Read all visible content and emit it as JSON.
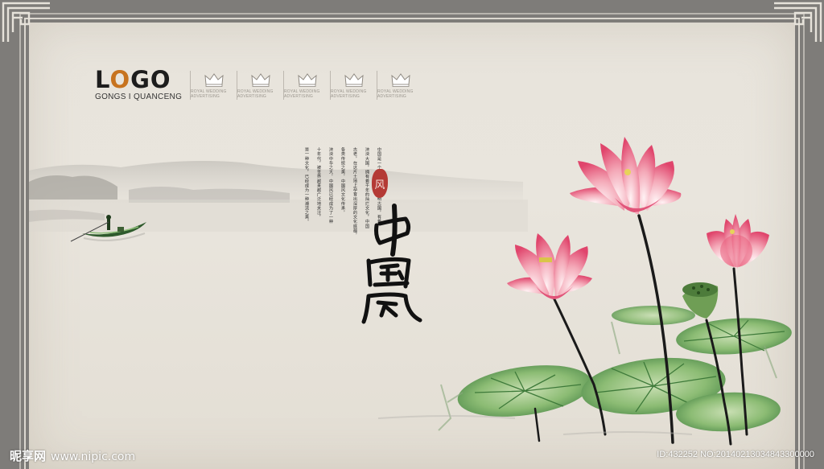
{
  "logo": {
    "title_part1": "L",
    "title_o": "O",
    "title_part2": "GO",
    "subtitle": "GONGS I QUANCENG"
  },
  "badges": [
    {
      "icon": "crown-icon",
      "caption": "ROYAL WEDDING ADVERTISING"
    },
    {
      "icon": "crown-icon",
      "caption": "ROYAL WEDDING ADVERTISING"
    },
    {
      "icon": "crown-icon",
      "caption": "ROYAL WEDDING ADVERTISING"
    },
    {
      "icon": "crown-icon",
      "caption": "ROYAL WEDDING ADVERTISING"
    },
    {
      "icon": "crown-icon",
      "caption": "ROYAL WEDDING ADVERTISING"
    }
  ],
  "text_columns": [
    "中国是一个历史悠久的文明古国，有着",
    "泱泱大国，拥有着千年的灿烂文化，中国",
    "古老，在这片土地上孕育出深厚的文化底蕴，",
    "各类传统之美，中国风文化传承，",
    "泱泱中华之大，中国风已经成为了一种",
    "十年代，被世界越来越广泛地关注，",
    "是一种文化，已经成为一种潮流之美。"
  ],
  "seal_char": "风",
  "calligraphy": "中國風",
  "watermark": {
    "site": "昵享网",
    "url": "www.nipic.com",
    "id_text": "ID:432252 NO:20140213034843300000"
  },
  "colors": {
    "frame": "#7e7c79",
    "paper": "#e8e4dc",
    "lotus": "#e46a86",
    "leaf": "#7fae6a",
    "seal": "#b43a35"
  }
}
